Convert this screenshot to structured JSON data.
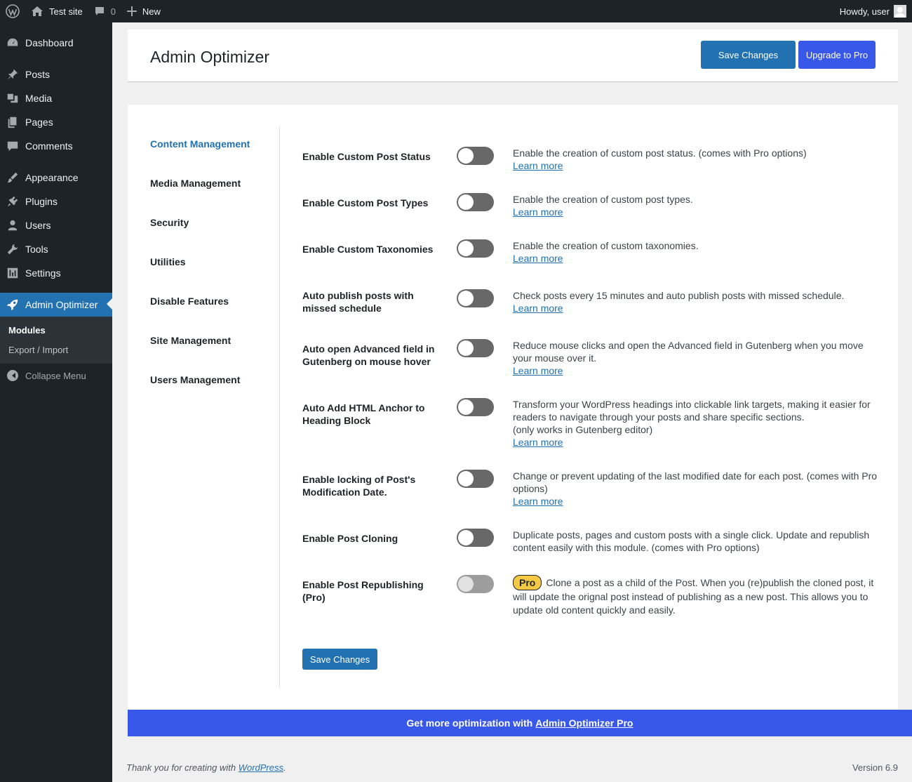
{
  "admin_bar": {
    "site_name": "Test site",
    "comments_count": "0",
    "new_label": "New",
    "howdy": "Howdy, user"
  },
  "menu": {
    "items": [
      {
        "label": "Dashboard",
        "icon": "dashboard-icon"
      },
      {
        "label": "Posts",
        "icon": "pin-icon"
      },
      {
        "label": "Media",
        "icon": "media-icon"
      },
      {
        "label": "Pages",
        "icon": "pages-icon"
      },
      {
        "label": "Comments",
        "icon": "comment-icon"
      },
      {
        "label": "Appearance",
        "icon": "brush-icon"
      },
      {
        "label": "Plugins",
        "icon": "plug-icon"
      },
      {
        "label": "Users",
        "icon": "user-icon"
      },
      {
        "label": "Tools",
        "icon": "wrench-icon"
      },
      {
        "label": "Settings",
        "icon": "sliders-icon"
      },
      {
        "label": "Admin Optimizer",
        "icon": "rocket-icon"
      }
    ],
    "submenu": [
      "Modules",
      "Export / Import"
    ],
    "collapse": "Collapse Menu"
  },
  "header": {
    "title": "Admin Optimizer",
    "save_label": "Save Changes",
    "upgrade_label": "Upgrade to Pro"
  },
  "tabs": [
    "Content Management",
    "Media Management",
    "Security",
    "Utilities",
    "Disable Features",
    "Site Management",
    "Users Management"
  ],
  "learn_more": "Learn more",
  "settings": [
    {
      "label": "Enable Custom Post Status",
      "desc": "Enable the creation of custom post status. (comes with Pro options)"
    },
    {
      "label": "Enable Custom Post Types",
      "desc": "Enable the creation of custom post types."
    },
    {
      "label": "Enable Custom Taxonomies",
      "desc": "Enable the creation of custom taxonomies."
    },
    {
      "label": "Auto publish posts with missed schedule",
      "desc": "Check posts every 15 minutes and auto publish posts with missed schedule."
    },
    {
      "label": "Auto open Advanced field in Gutenberg on mouse hover",
      "desc": "Reduce mouse clicks and open the Advanced field in Gutenberg when you move your mouse over it."
    },
    {
      "label": "Auto Add HTML Anchor to Heading Block",
      "desc": "Transform your WordPress headings into clickable link targets, making it easier for readers to navigate through your posts and share specific sections.",
      "desc_note": "(only works in Gutenberg editor)"
    },
    {
      "label": "Enable locking of Post's Modification Date.",
      "desc": "Change or prevent updating of the last modified date for each post. (comes with Pro options)"
    },
    {
      "label": "Enable Post Cloning",
      "desc": "Duplicate posts, pages and custom posts with a single click. Update and republish content easily with this module. (comes with Pro options)"
    },
    {
      "label": "Enable Post Republishing (Pro)",
      "badge": "Pro",
      "desc": "Clone a post as a child of the Post. When you (re)publish the cloned post, it will update the orignal post instead of publishing as a new post. This allows you to update old content quickly and easily."
    }
  ],
  "save_bottom": "Save Changes",
  "promo": {
    "text": "Get more optimization with",
    "link": "Admin Optimizer Pro"
  },
  "footer": {
    "thanks": "Thank you for creating with",
    "wp_link": "WordPress",
    "period": ".",
    "version": "Version 6.9"
  }
}
